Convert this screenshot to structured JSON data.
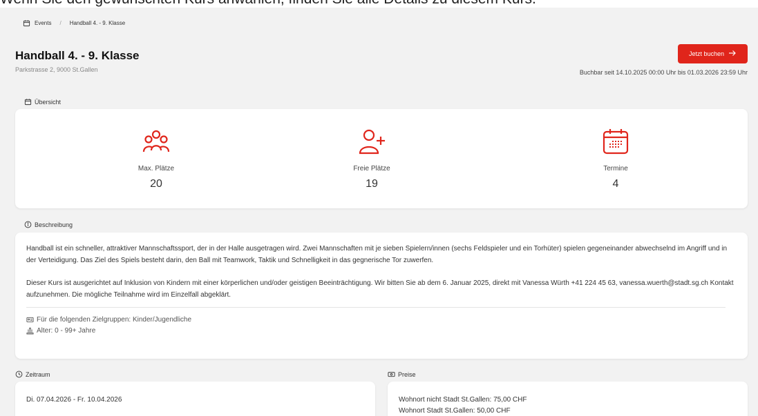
{
  "top_banner": "Wenn Sie den gewünschten Kurs anwählen, finden Sie alle Details zu diesem Kurs.",
  "breadcrumb": {
    "root": "Events",
    "current": "Handball 4. - 9. Klasse"
  },
  "event": {
    "title": "Handball 4. - 9. Klasse",
    "address": "Parkstrasse 2, 9000 St.Gallen",
    "book_label": "Jetzt buchen",
    "bookable": "Buchbar seit 14.10.2025 00:00 Uhr bis 01.03.2026 23:59 Uhr"
  },
  "overview": {
    "label": "Übersicht",
    "stats": [
      {
        "icon": "users-icon",
        "label": "Max. Plätze",
        "value": "20"
      },
      {
        "icon": "user-plus-icon",
        "label": "Freie Plätze",
        "value": "19"
      },
      {
        "icon": "calendar-icon",
        "label": "Termine",
        "value": "4"
      }
    ]
  },
  "description": {
    "label": "Beschreibung",
    "paragraph1": "Handball ist ein schneller, attraktiver Mannschaftssport, der in der Halle ausgetragen wird. Zwei Mannschaften mit je sieben Spielern/innen (sechs Feldspieler und ein Torhüter) spielen gegeneinander abwechselnd im Angriff und in der Verteidigung. Das Ziel des Spiels besteht darin, den Ball mit Teamwork, Taktik und Schnelligkeit in das gegnerische Tor zuwerfen.",
    "paragraph2": "Dieser Kurs ist ausgerichtet auf Inklusion von Kindern mit einer körperlichen und/oder geistigen Beeinträchtigung. Wir bitten Sie ab dem 6. Januar 2025, direkt mit Vanessa Würth +41 224 45 63, vanessa.wuerth@stadt.sg.ch Kontakt aufzunehmen. Die mögliche Teilnahme wird im Einzelfall abgeklärt.",
    "target_groups": "Für die folgenden Zielgruppen: Kinder/Jugendliche",
    "age": "Alter: 0 - 99+ Jahre"
  },
  "timeframe": {
    "label": "Zeitraum",
    "value": "Di. 07.04.2026 - Fr. 10.04.2026"
  },
  "prices": {
    "label": "Preise",
    "items": [
      "Wohnort nicht Stadt St.Gallen: 75,00 CHF",
      "Wohnort Stadt St.Gallen: 50,00 CHF"
    ]
  },
  "colors": {
    "accent": "#e0251b",
    "background": "#f2f2f2"
  }
}
